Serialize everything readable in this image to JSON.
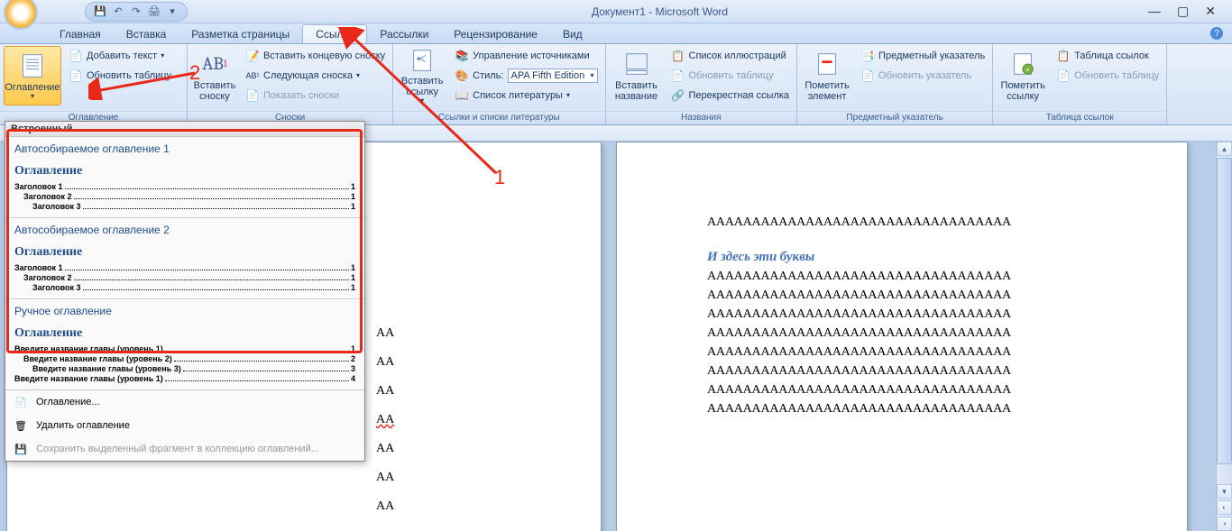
{
  "window": {
    "title": "Документ1 - Microsoft Word",
    "office_abbr": ""
  },
  "qat": {
    "save": "💾",
    "undo": "↶",
    "redo": "↷",
    "print": "🖨",
    "more": "▾"
  },
  "win_controls": {
    "min": "—",
    "max": "▢",
    "close": "✕"
  },
  "tabs": {
    "home": "Главная",
    "insert": "Вставка",
    "layout": "Разметка страницы",
    "references": "Ссылки",
    "mailings": "Рассылки",
    "review": "Рецензирование",
    "view": "Вид"
  },
  "ribbon": {
    "toc_group": {
      "label": "Оглавление",
      "main_btn": "Оглавление",
      "add_text": "Добавить текст",
      "update": "Обновить таблицу"
    },
    "footnotes_group": {
      "label": "Сноски",
      "insert_footnote": "Вставить сноску",
      "ab": "AB",
      "insert_endnote": "Вставить концевую сноску",
      "next": "Следующая сноска",
      "show": "Показать сноски"
    },
    "citations_group": {
      "label": "Ссылки и списки литературы",
      "insert_citation": "Вставить ссылку",
      "manage": "Управление источниками",
      "style_label": "Стиль:",
      "style_value": "APA Fifth Edition",
      "biblio": "Список литературы"
    },
    "captions_group": {
      "label": "Названия",
      "insert_caption": "Вставить название",
      "list_figures": "Список иллюстраций",
      "update_table": "Обновить таблицу",
      "cross_ref": "Перекрестная ссылка"
    },
    "index_group": {
      "label": "Предметный указатель",
      "mark_entry": "Пометить элемент",
      "index": "Предметный указатель",
      "update_index": "Обновить указатель"
    },
    "authorities_group": {
      "label": "Таблица ссылок",
      "mark_citation": "Пометить ссылку",
      "table_auth": "Таблица ссылок",
      "update_auth": "Обновить таблицу"
    }
  },
  "gallery": {
    "builtin_header": "Встроенный",
    "auto1": {
      "title": "Автособираемое оглавление 1",
      "heading": "Оглавление",
      "rows": [
        {
          "label": "Заголовок 1",
          "page": "1",
          "lvl": 1
        },
        {
          "label": "Заголовок 2",
          "page": "1",
          "lvl": 2
        },
        {
          "label": "Заголовок 3",
          "page": "1",
          "lvl": 3
        }
      ]
    },
    "auto2": {
      "title": "Автособираемое оглавление 2",
      "heading": "Оглавление",
      "rows": [
        {
          "label": "Заголовок 1",
          "page": "1",
          "lvl": 1
        },
        {
          "label": "Заголовок 2",
          "page": "1",
          "lvl": 2
        },
        {
          "label": "Заголовок 3",
          "page": "1",
          "lvl": 3
        }
      ]
    },
    "manual": {
      "title": "Ручное оглавление",
      "heading": "Оглавление",
      "rows": [
        {
          "label": "Введите название главы (уровень 1)",
          "page": "1",
          "lvl": 1
        },
        {
          "label": "Введите название главы (уровень 2)",
          "page": "2",
          "lvl": 2
        },
        {
          "label": "Введите название главы (уровень 3)",
          "page": "3",
          "lvl": 3
        },
        {
          "label": "Введите название главы (уровень 1)",
          "page": "4",
          "lvl": 1
        }
      ]
    },
    "menu_insert": "Оглавление...",
    "menu_remove": "Удалить оглавление",
    "menu_save": "Сохранить выделенный фрагмент в коллекцию оглавлений..."
  },
  "document": {
    "line": "АААААААААААААААААААААААААААААААААА",
    "heading": "И здесь эти буквы",
    "cut_line": "АА"
  },
  "annotations": {
    "num1": "1",
    "num2": "2"
  }
}
